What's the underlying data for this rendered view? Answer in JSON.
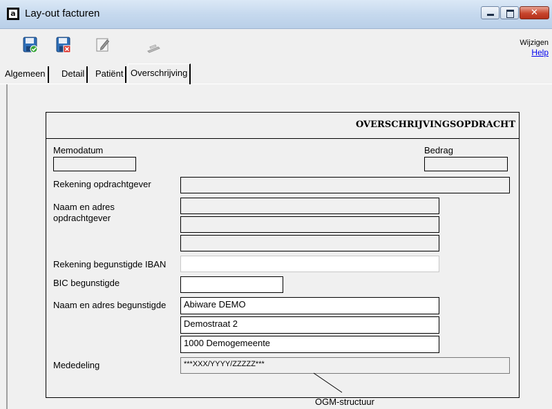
{
  "window": {
    "icon_letter": "a",
    "title": "Lay-out facturen"
  },
  "toolbar": {
    "save_icon": "save-disk-check-icon",
    "cancel_icon": "save-disk-cancel-icon",
    "edit_icon": "edit-pencil-icon",
    "print_icon": "printer-icon",
    "mode_label": "Wijzigen",
    "help_label": "Help"
  },
  "tabs": [
    {
      "label": "Algemeen"
    },
    {
      "label": "Detail"
    },
    {
      "label": "Patiënt"
    },
    {
      "label": "Overschrijving",
      "active": true
    }
  ],
  "form": {
    "heading": "OVERSCHRIJVINGSOPDRACHT",
    "memodatum_label": "Memodatum",
    "memodatum_value": "",
    "bedrag_label": "Bedrag",
    "bedrag_value": "",
    "rek_opdrachtgever_label": "Rekening opdrachtgever",
    "rek_opdrachtgever_value": "",
    "naam_opdrachtgever_label": "Naam en adres opdrachtgever",
    "opdrachtgever_lines": [
      "",
      "",
      ""
    ],
    "rek_begunstigde_label": "Rekening begunstigde IBAN",
    "rek_begunstigde_value": "",
    "bic_label": "BIC begunstigde",
    "bic_value": "",
    "naam_begunstigde_label": "Naam en adres begunstigde",
    "begunstigde_lines": [
      "Abiware DEMO",
      "Demostraat 2",
      "1000 Demogemeente"
    ],
    "mededeling_label": "Mededeling",
    "mededeling_value": "***XXX/YYYY/ZZZZZ***",
    "ogm_label": "OGM-structuur"
  },
  "colors": {
    "window_bg": "#f0f0f0",
    "title_gradient_top": "#dbe8f6",
    "close_button": "#c7452d",
    "link": "#0000ee"
  }
}
